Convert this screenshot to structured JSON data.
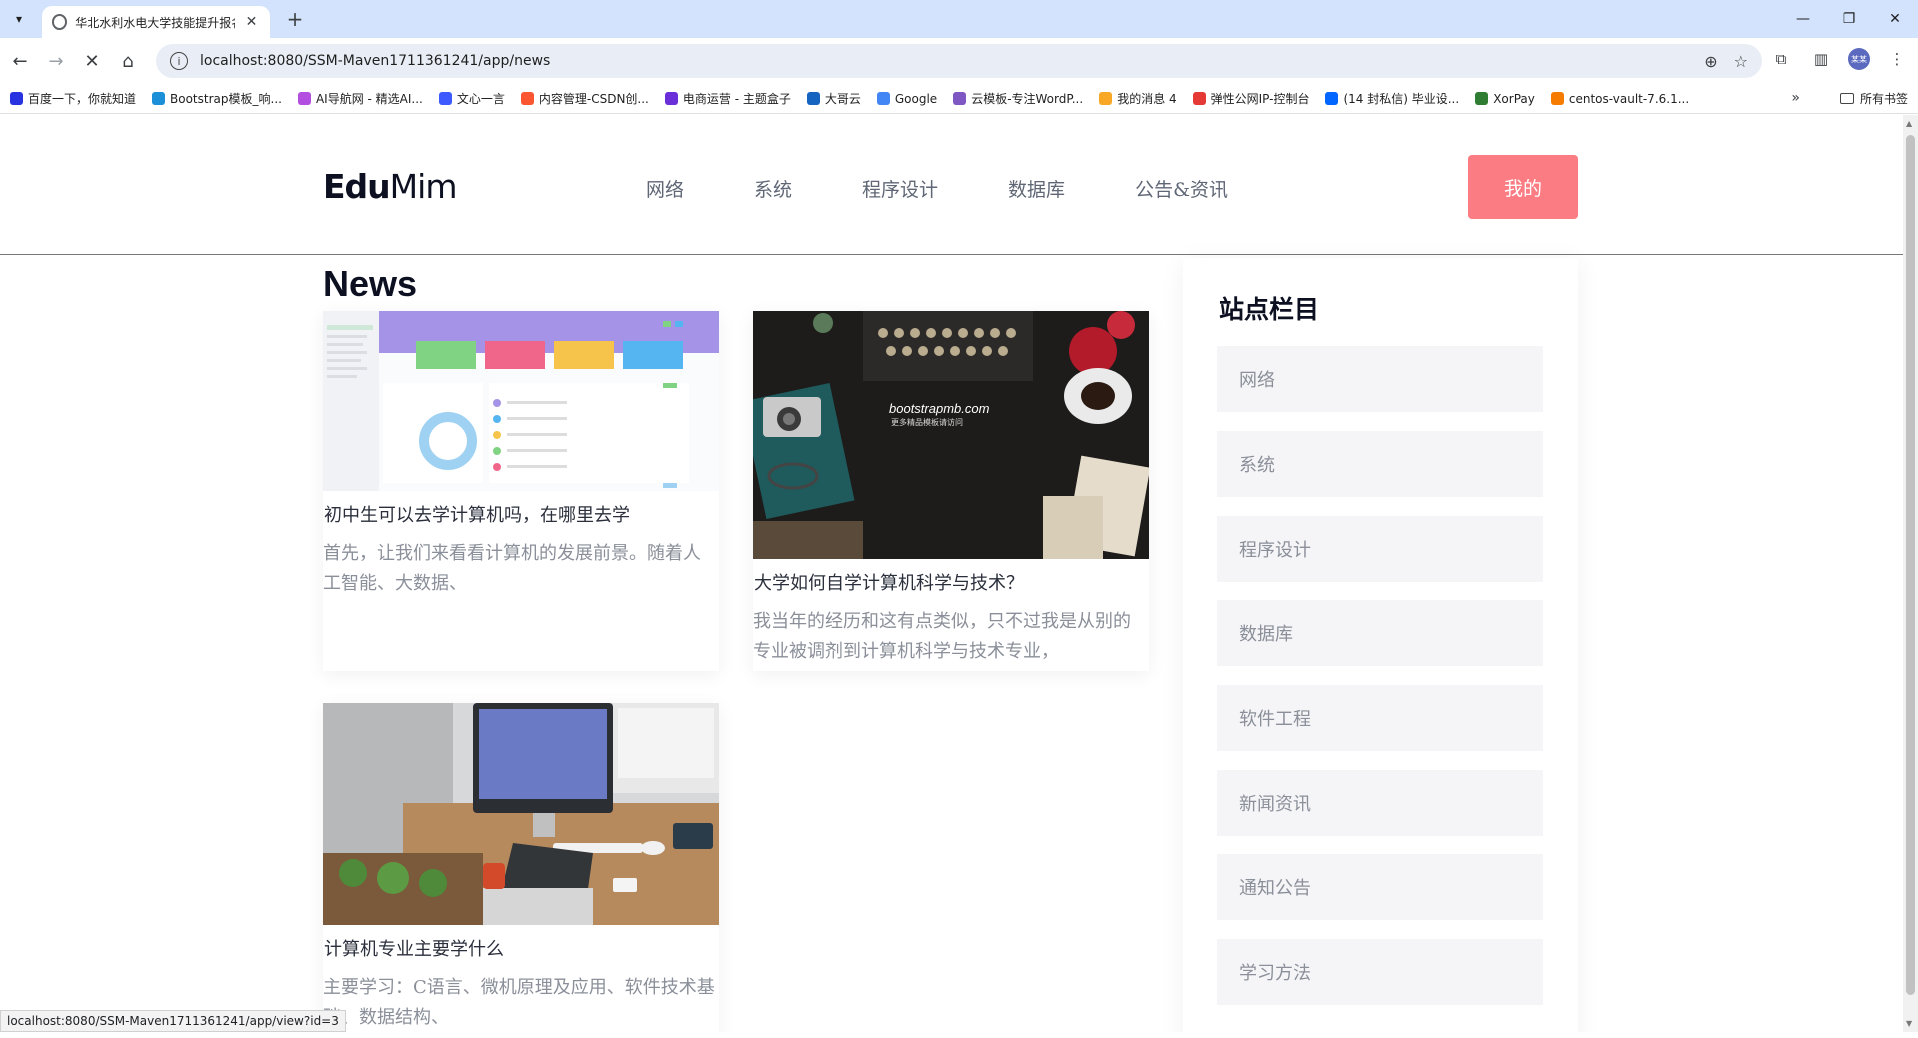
{
  "browser": {
    "tab_title": "华北水利水电大学技能提升报名",
    "url": "localhost:8080/SSM-Maven1711361241/app/news",
    "status_url": "localhost:8080/SSM-Maven1711361241/app/view?id=3",
    "profile_label": "某某",
    "bookmarks": [
      {
        "label": "百度一下，你就知道",
        "color": "#2932e1"
      },
      {
        "label": "Bootstrap模板_响...",
        "color": "#1c8fd9"
      },
      {
        "label": "AI导航网 - 精选AI...",
        "color": "#b34fe0"
      },
      {
        "label": "文心一言",
        "color": "#3d5afe"
      },
      {
        "label": "内容管理-CSDN创...",
        "color": "#fc5531"
      },
      {
        "label": "电商运营 - 主题盒子",
        "color": "#6a2fd9"
      },
      {
        "label": "大哥云",
        "color": "#1565c0"
      },
      {
        "label": "Google",
        "color": "#4285f4"
      },
      {
        "label": "云模板-专注WordP...",
        "color": "#7e57c2"
      },
      {
        "label": "我的消息 4",
        "color": "#f9a825"
      },
      {
        "label": "弹性公网IP-控制台",
        "color": "#e53935"
      },
      {
        "label": "(14 封私信) 毕业设...",
        "color": "#0066ff"
      },
      {
        "label": "XorPay",
        "color": "#2e7d32"
      },
      {
        "label": "centos-vault-7.6.1...",
        "color": "#f57c00"
      }
    ],
    "all_bookmarks": "所有书签"
  },
  "header": {
    "logo_bold": "Edu",
    "logo_light": "Mim",
    "nav": [
      "网络",
      "系统",
      "程序设计",
      "数据库",
      "公告&资讯"
    ],
    "my_button": "我的"
  },
  "page": {
    "title": "News",
    "articles": [
      {
        "title": "初中生可以去学计算机吗，在哪里去学",
        "desc": "首先，让我们来看看计算机的发展前景。随着人工智能、大数据、"
      },
      {
        "title": "大学如何自学计算机科学与技术？",
        "desc": "我当年的经历和这有点类似，只不过我是从别的专业被调剂到计算机科学与技术专业，",
        "image_caption": "bootstrapmb.com",
        "image_subcaption": "更多精品模板请访问"
      },
      {
        "title": "计算机专业主要学什么",
        "desc": "主要学习：C语言、微机原理及应用、软件技术基础、数据结构、"
      }
    ]
  },
  "sidebar": {
    "title": "站点栏目",
    "items": [
      "网络",
      "系统",
      "程序设计",
      "数据库",
      "软件工程",
      "新闻资讯",
      "通知公告",
      "学习方法"
    ]
  },
  "colors": {
    "accent": "#fb7c82",
    "tabbar": "#d3e3fd",
    "heading": "#0c1021",
    "muted_text": "#8a8f99"
  }
}
